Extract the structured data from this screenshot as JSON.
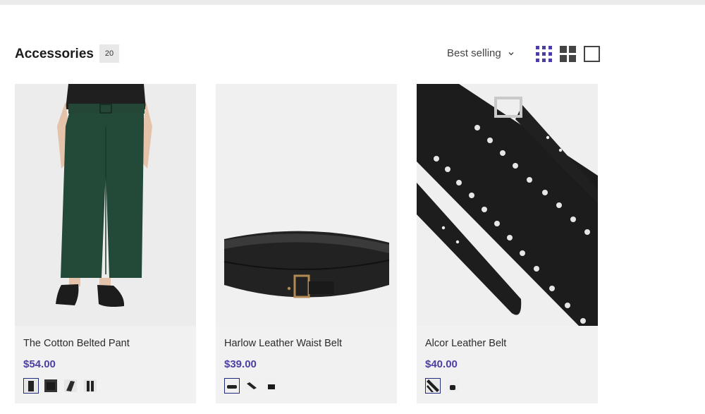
{
  "collection": {
    "title": "Accessories",
    "count": "20",
    "sort_label": "Best selling"
  },
  "colors": {
    "accent": "#4b3fa6",
    "active_view": "#4b3fa6",
    "card_bg": "#f1f1f1"
  },
  "view_options": [
    "small-grid-icon",
    "large-grid-icon",
    "list-icon"
  ],
  "products": [
    {
      "name": "The Cotton Belted Pant",
      "price": "$54.00",
      "swatch_count": 4
    },
    {
      "name": "Harlow Leather Waist Belt",
      "price": "$39.00",
      "swatch_count": 3
    },
    {
      "name": "Alcor Leather Belt",
      "price": "$40.00",
      "swatch_count": 2
    }
  ]
}
